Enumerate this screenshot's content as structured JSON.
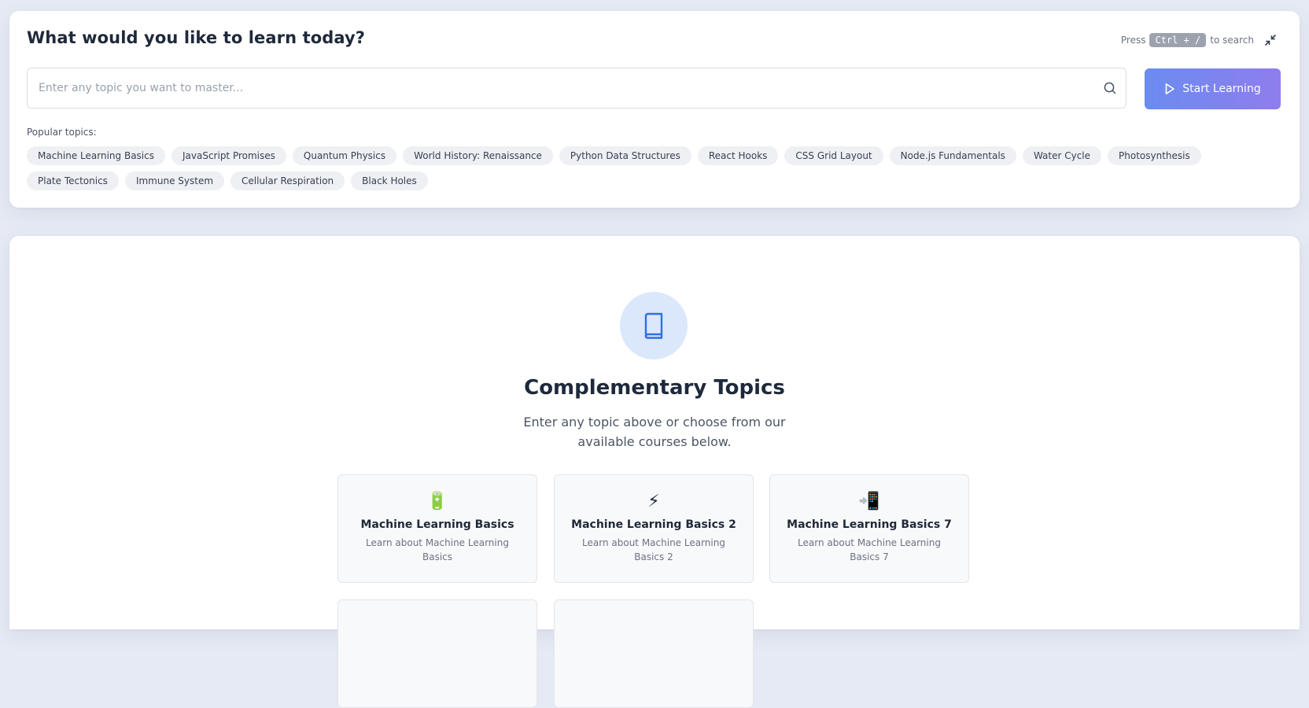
{
  "search_panel": {
    "title": "What would you like to learn today?",
    "shortcut_prefix": "Press",
    "shortcut_key": "Ctrl + /",
    "shortcut_suffix": "to search",
    "search_placeholder": "Enter any topic you want to master...",
    "search_value": "",
    "start_button_label": "Start Learning",
    "popular_label": "Popular topics:",
    "popular_topics": [
      "Machine Learning Basics",
      "JavaScript Promises",
      "Quantum Physics",
      "World History: Renaissance",
      "Python Data Structures",
      "React Hooks",
      "CSS Grid Layout",
      "Node.js Fundamentals",
      "Water Cycle",
      "Photosynthesis",
      "Plate Tectonics",
      "Immune System",
      "Cellular Respiration",
      "Black Holes"
    ]
  },
  "main_panel": {
    "icon": "book-icon",
    "title": "Complementary Topics",
    "subtitle": "Enter any topic above or choose from our available courses below.",
    "courses": [
      {
        "emoji": "🔋",
        "title": "Machine Learning Basics",
        "description": "Learn about Machine Learning Basics"
      },
      {
        "emoji": "⚡",
        "title": "Machine Learning Basics 2",
        "description": "Learn about Machine Learning Basics 2"
      },
      {
        "emoji": "📲",
        "title": "Machine Learning Basics 7",
        "description": "Learn about Machine Learning Basics 7"
      }
    ]
  },
  "colors": {
    "background": "#e6eaf4",
    "accent_start": "#6a8cf0",
    "accent_end": "#8f7ded",
    "hero_icon_bg": "#dbe8fb",
    "hero_icon_stroke": "#2f6fe0"
  }
}
